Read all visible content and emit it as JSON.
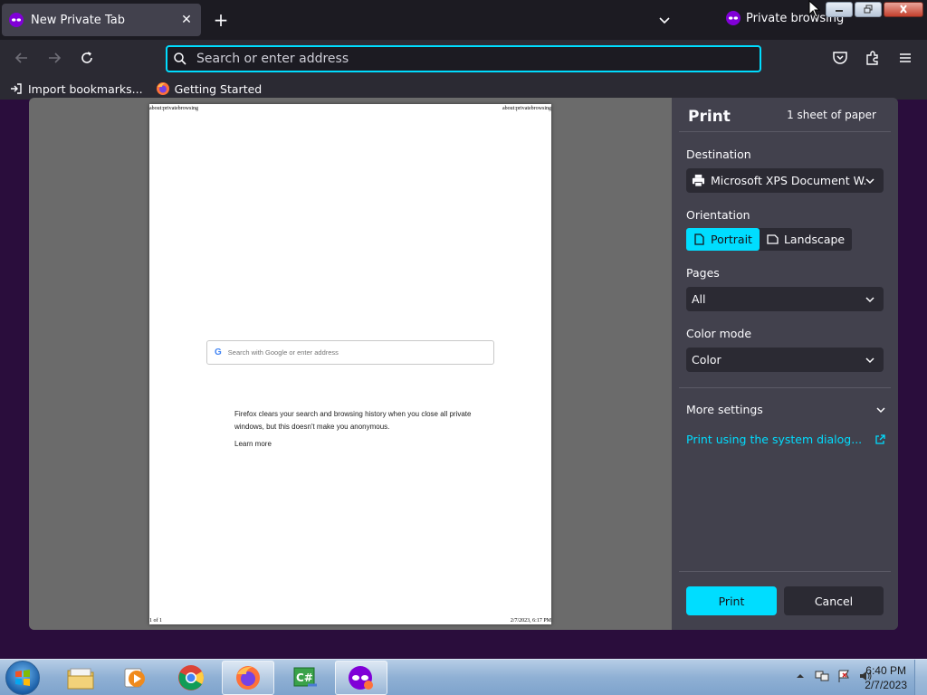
{
  "browser": {
    "tab": {
      "title": "New Private Tab"
    },
    "private_indicator": "Private browsing",
    "urlbar": {
      "placeholder": "Search or enter address"
    },
    "bookmarks": [
      {
        "label": "Import bookmarks..."
      },
      {
        "label": "Getting Started"
      }
    ]
  },
  "preview": {
    "header_left": "about:privatebrowsing",
    "header_right": "about:privatebrowsing",
    "search_placeholder": "Search with Google or enter address",
    "message": "Firefox clears your search and browsing history when you close all private windows, but this doesn't make you anonymous.",
    "learn_more": "Learn more",
    "footer_left": "1 of 1",
    "footer_right": "2/7/2023, 6:17 PM"
  },
  "print": {
    "title": "Print",
    "sheets": "1 sheet of paper",
    "destination_label": "Destination",
    "destination_value": "Microsoft XPS Document W...",
    "orientation_label": "Orientation",
    "portrait": "Portrait",
    "landscape": "Landscape",
    "pages_label": "Pages",
    "pages_value": "All",
    "color_label": "Color mode",
    "color_value": "Color",
    "more_settings": "More settings",
    "system_dialog": "Print using the system dialog...",
    "print_button": "Print",
    "cancel_button": "Cancel"
  },
  "taskbar": {
    "time": "6:40 PM",
    "date": "2/7/2023"
  },
  "colors": {
    "accent": "#00ddff",
    "private_bg": "#2a0d3c"
  }
}
